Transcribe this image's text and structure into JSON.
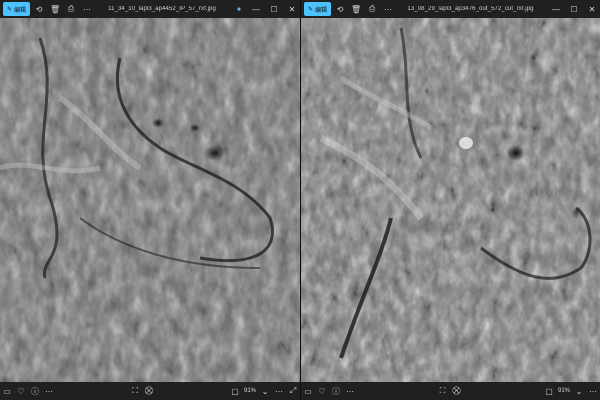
{
  "left": {
    "edit_label": "编辑",
    "filename": "11_34_10_lapl3_ap4452_IP_57_rxf.jpg",
    "zoom": "91%"
  },
  "right": {
    "edit_label": "编辑",
    "filename": "13_08_29_lapl3_ap3476_out_572_cut_rxf.jpg",
    "zoom": "91%"
  },
  "icons": {
    "edit": "✎",
    "rotate": "⟲",
    "delete": "🗑",
    "print": "⎙",
    "more": "⋯",
    "designer": "✦",
    "minimize": "—",
    "maximize": "☐",
    "close": "✕",
    "info": "ⓘ",
    "heart": "♡",
    "slideshow": "▭",
    "crop": "⛶",
    "enhance": "⛒",
    "fit": "▢",
    "chevron": "⌄",
    "fullscreen": "⤢"
  }
}
